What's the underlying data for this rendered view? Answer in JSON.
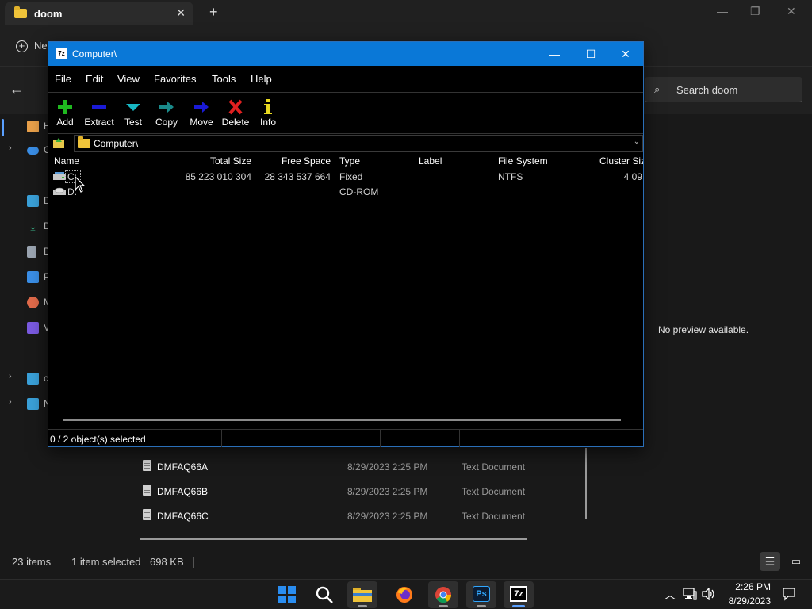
{
  "explorer": {
    "tab_title": "doom",
    "new_label": "Ne",
    "search_placeholder": "Search doom",
    "preview_text": "No preview available.",
    "sidebar": [
      {
        "label": "H",
        "icon": "home-icon",
        "color": "#e8a04a"
      },
      {
        "label": "C",
        "icon": "cloud-icon",
        "color": "#3a8ee6"
      },
      {
        "label": "D",
        "icon": "desktop-icon",
        "color": "#3aa0d8"
      },
      {
        "label": "D",
        "icon": "download-icon",
        "color": "#3bb58a"
      },
      {
        "label": "D",
        "icon": "document-icon",
        "color": "#9aa4b0"
      },
      {
        "label": "P",
        "icon": "pictures-icon",
        "color": "#3a8ee6"
      },
      {
        "label": "M",
        "icon": "music-icon",
        "color": "#e06a4a"
      },
      {
        "label": "V",
        "icon": "videos-icon",
        "color": "#7a5ae0"
      },
      {
        "label": "c",
        "icon": "this-pc-icon",
        "color": "#3aa0d8"
      },
      {
        "label": "N",
        "icon": "network-icon",
        "color": "#3aa0d8"
      }
    ],
    "files": [
      {
        "name": "DMFAQ66A",
        "date": "8/29/2023 2:25 PM",
        "type": "Text Document"
      },
      {
        "name": "DMFAQ66B",
        "date": "8/29/2023 2:25 PM",
        "type": "Text Document"
      },
      {
        "name": "DMFAQ66C",
        "date": "8/29/2023 2:25 PM",
        "type": "Text Document"
      }
    ],
    "status": {
      "items_count": "23 items",
      "selected": "1 item selected",
      "size": "698 KB"
    }
  },
  "sevenzip": {
    "title": "Computer\\",
    "app_icon_text": "7z",
    "menu": [
      "File",
      "Edit",
      "View",
      "Favorites",
      "Tools",
      "Help"
    ],
    "toolbar": [
      {
        "label": "Add",
        "icon": "add-icon"
      },
      {
        "label": "Extract",
        "icon": "extract-icon"
      },
      {
        "label": "Test",
        "icon": "test-icon"
      },
      {
        "label": "Copy",
        "icon": "copy-icon"
      },
      {
        "label": "Move",
        "icon": "move-icon"
      },
      {
        "label": "Delete",
        "icon": "delete-icon"
      },
      {
        "label": "Info",
        "icon": "info-icon"
      }
    ],
    "address": "Computer\\",
    "columns": [
      "Name",
      "Total Size",
      "Free Space",
      "Type",
      "Label",
      "File System",
      "Cluster Siz"
    ],
    "rows": [
      {
        "name": "C:",
        "total_size": "85 223 010 304",
        "free_space": "28 343 537 664",
        "type": "Fixed",
        "label": "",
        "file_system": "NTFS",
        "cluster": "4 09"
      },
      {
        "name": "D:",
        "total_size": "",
        "free_space": "",
        "type": "CD-ROM",
        "label": "",
        "file_system": "",
        "cluster": ""
      }
    ],
    "status": "0 / 2 object(s) selected"
  },
  "taskbar": {
    "apps": [
      {
        "name": "start-button",
        "icon": "windows-logo-icon"
      },
      {
        "name": "search-button",
        "icon": "search-icon"
      },
      {
        "name": "file-explorer-app",
        "icon": "folder-icon"
      },
      {
        "name": "firefox-app",
        "icon": "firefox-icon"
      },
      {
        "name": "chrome-app",
        "icon": "chrome-icon"
      },
      {
        "name": "photoshop-app",
        "icon": "photoshop-icon",
        "text": "Ps"
      },
      {
        "name": "sevenzip-app",
        "icon": "sevenzip-icon",
        "text": "7z"
      }
    ],
    "time": "2:26 PM",
    "date": "8/29/2023"
  },
  "colors": {
    "accent": "#0a78d7",
    "taskbar_indicator": "#5aa0ff"
  }
}
